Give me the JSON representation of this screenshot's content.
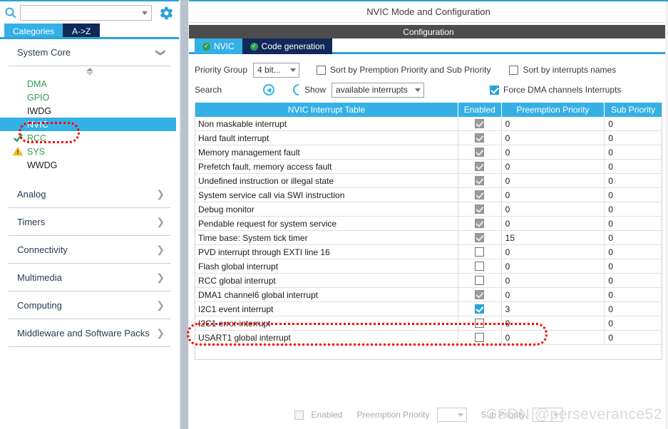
{
  "sidebar": {
    "search": {
      "value": "",
      "placeholder": ""
    },
    "gear_icon": "gear-icon",
    "search_icon": "search-icon",
    "tabs": [
      {
        "label": "Categories",
        "active": true
      },
      {
        "label": "A->Z",
        "active": false
      }
    ],
    "section": {
      "title": "System Core"
    },
    "ip_items": [
      {
        "label": "DMA",
        "state": "configured"
      },
      {
        "label": "GPIO",
        "state": "configured"
      },
      {
        "label": "IWDG",
        "state": "none"
      },
      {
        "label": "NVIC",
        "state": "selected"
      },
      {
        "label": "RCC",
        "state": "ok"
      },
      {
        "label": "SYS",
        "state": "warning"
      },
      {
        "label": "WWDG",
        "state": "none"
      }
    ],
    "categories": [
      {
        "label": "Analog"
      },
      {
        "label": "Timers"
      },
      {
        "label": "Connectivity"
      },
      {
        "label": "Multimedia"
      },
      {
        "label": "Computing"
      },
      {
        "label": "Middleware and Software Packs"
      }
    ]
  },
  "main": {
    "mode_title": "NVIC Mode and Configuration",
    "configuration_bar": "Configuration",
    "tabs": [
      {
        "label": "NVIC",
        "active": true
      },
      {
        "label": "Code generation",
        "active": false
      }
    ],
    "options": {
      "priority_group_label": "Priority Group",
      "priority_group_value": "4 bit...",
      "sort_premption_label": "Sort by Premption Priority and Sub Priority",
      "sort_premption_checked": false,
      "sort_names_label": "Sort by interrupts names",
      "sort_names_checked": false,
      "search_label": "Search",
      "show_label": "Show",
      "show_value": "available interrupts",
      "force_dma_label": "Force DMA channels Interrupts",
      "force_dma_checked": true
    },
    "table": {
      "headers": [
        "NVIC Interrupt Table",
        "Enabled",
        "Preemption Priority",
        "Sub Priority"
      ],
      "rows": [
        {
          "name": "Non maskable interrupt",
          "enabled": "locked",
          "pre": "0",
          "sub": "0",
          "dim": true
        },
        {
          "name": "Hard fault interrupt",
          "enabled": "locked",
          "pre": "0",
          "sub": "0",
          "dim": true
        },
        {
          "name": "Memory management fault",
          "enabled": "locked",
          "pre": "0",
          "sub": "0",
          "dim": false
        },
        {
          "name": "Prefetch fault, memory access fault",
          "enabled": "locked",
          "pre": "0",
          "sub": "0",
          "dim": false
        },
        {
          "name": "Undefined instruction or illegal state",
          "enabled": "locked",
          "pre": "0",
          "sub": "0",
          "dim": false
        },
        {
          "name": "System service call via SWI instruction",
          "enabled": "locked",
          "pre": "0",
          "sub": "0",
          "dim": false
        },
        {
          "name": "Debug monitor",
          "enabled": "locked",
          "pre": "0",
          "sub": "0",
          "dim": false
        },
        {
          "name": "Pendable request for system service",
          "enabled": "locked",
          "pre": "0",
          "sub": "0",
          "dim": false
        },
        {
          "name": "Time base: System tick timer",
          "enabled": "locked",
          "pre": "15",
          "sub": "0",
          "dim": false
        },
        {
          "name": "PVD interrupt through EXTI line 16",
          "enabled": "off",
          "pre": "0",
          "sub": "0",
          "dim": false
        },
        {
          "name": "Flash global interrupt",
          "enabled": "off",
          "pre": "0",
          "sub": "0",
          "dim": false
        },
        {
          "name": "RCC global interrupt",
          "enabled": "off",
          "pre": "0",
          "sub": "0",
          "dim": false
        },
        {
          "name": "DMA1 channel6 global interrupt",
          "enabled": "locked",
          "pre": "0",
          "sub": "0",
          "dim": false
        },
        {
          "name": "I2C1 event interrupt",
          "enabled": "on",
          "pre": "3",
          "sub": "0",
          "dim": false
        },
        {
          "name": "I2C1 error interrupt",
          "enabled": "off",
          "pre": "0",
          "sub": "0",
          "dim": false
        },
        {
          "name": "USART1 global interrupt",
          "enabled": "off",
          "pre": "0",
          "sub": "0",
          "dim": false
        }
      ]
    },
    "bottom": {
      "enabled_label": "Enabled",
      "enabled_checked": false,
      "preemption_label": "Preemption Priority",
      "preemption_value": "",
      "sub_label": "Sub Priority",
      "sub_value": ""
    },
    "watermark": "CSDN @perseverance52"
  },
  "colors": {
    "accent_blue": "#35b0e5",
    "dark_navy": "#11285a",
    "config_gray": "#4c4c4c",
    "green": "#2e9e52",
    "warning_yellow": "#f2c01e",
    "annotation_red": "#ff0000"
  }
}
